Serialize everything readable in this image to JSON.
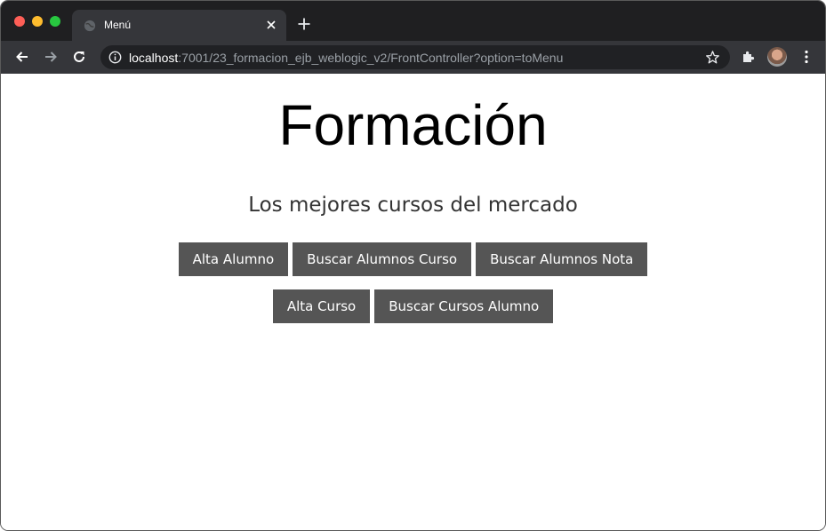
{
  "browser": {
    "tab": {
      "title": "Menú"
    },
    "address_bar": {
      "host": "localhost",
      "path": ":7001/23_formacion_ejb_weblogic_v2/FrontController?option=toMenu"
    }
  },
  "page": {
    "title": "Formación",
    "subtitle": "Los mejores cursos del mercado",
    "buttons_row1": [
      "Alta Alumno",
      "Buscar Alumnos Curso",
      "Buscar Alumnos Nota"
    ],
    "buttons_row2": [
      "Alta Curso",
      "Buscar Cursos Alumno"
    ]
  },
  "colors": {
    "button_bg": "#555555",
    "button_text": "#ffffff",
    "tabstrip_bg": "#1f1f21",
    "toolbar_bg": "#35363a"
  },
  "icons": {
    "tab_favicon": "globe-icon",
    "tab_close": "close-icon",
    "new_tab": "plus-icon",
    "back": "back-arrow-icon",
    "forward": "forward-arrow-icon",
    "reload": "reload-icon",
    "site_info": "info-icon",
    "bookmark": "star-icon",
    "extensions": "puzzle-icon",
    "menu": "kebab-menu-icon"
  }
}
